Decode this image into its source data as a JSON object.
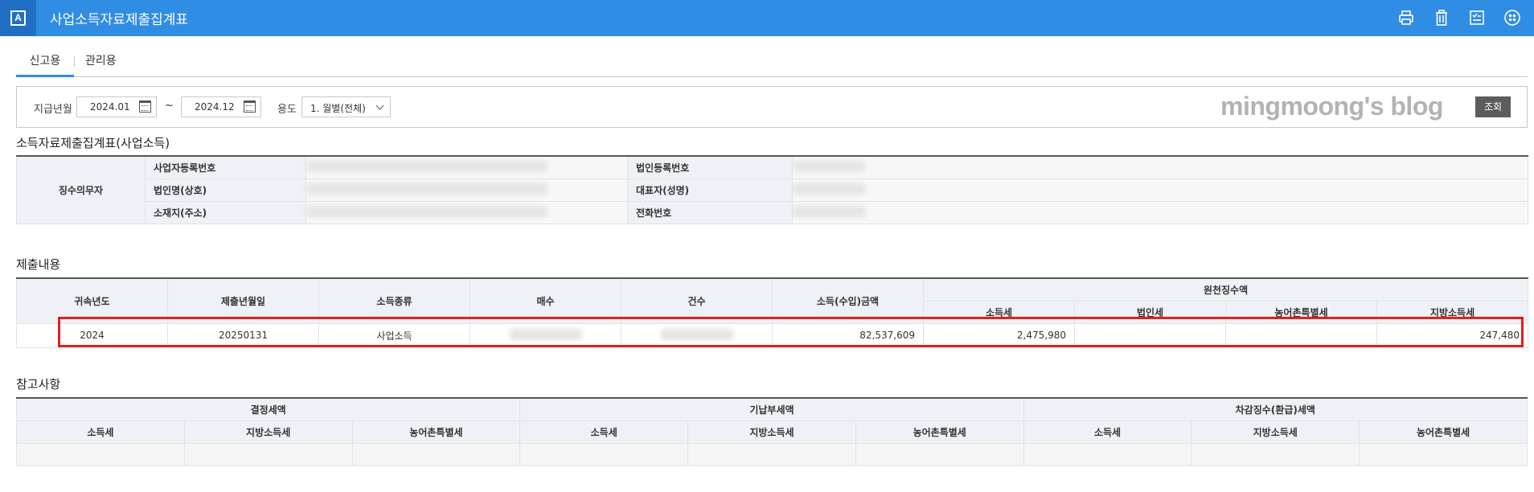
{
  "titlebar": {
    "app_icon_letter": "A",
    "title": "사업소득자료제출집계표",
    "icons": [
      "print-icon",
      "trash-icon",
      "checklist-icon",
      "more-icon"
    ]
  },
  "tabs": [
    {
      "label": "신고용",
      "active": true
    },
    {
      "label": "관리용",
      "active": false
    }
  ],
  "search": {
    "period_label": "지급년월",
    "from": "2024.01",
    "separator": "~",
    "to": "2024.12",
    "purpose_label": "용도",
    "purpose_value": "1. 월별(전체)",
    "watermark": "mingmoong's blog",
    "query_button": "조회"
  },
  "section1": {
    "title": "소득자료제출집계표(사업소득)",
    "group_label": "징수의무자",
    "labels": {
      "biz_reg_no": "사업자등록번호",
      "corp_name": "법인명(상호)",
      "address": "소재지(주소)",
      "corp_reg_no": "법인등록번호",
      "representative": "대표자(성명)",
      "phone": "전화번호"
    }
  },
  "section2": {
    "title": "제출내용",
    "headers": {
      "year": "귀속년도",
      "submit_date": "제출년월일",
      "income_type": "소득종류",
      "sheets": "매수",
      "count": "건수",
      "amount": "소득(수입)금액",
      "withholding": "원천징수액",
      "income_tax": "소득세",
      "corp_tax": "법인세",
      "rural_tax": "농어촌특별세",
      "local_tax": "지방소득세"
    },
    "row": {
      "year": "2024",
      "submit_date": "20250131",
      "income_type": "사업소득",
      "amount": "82,537,609",
      "income_tax": "2,475,980",
      "corp_tax": "",
      "rural_tax": "",
      "local_tax": "247,480"
    },
    "highlight_color": "#e02020"
  },
  "section3": {
    "title": "참고사항",
    "groups": [
      "결정세액",
      "기납부세액",
      "차감징수(환급)세액"
    ],
    "sub_headers": [
      "소득세",
      "지방소득세",
      "농어촌특별세"
    ]
  },
  "colors": {
    "titlebar": "#2f8de4",
    "accent": "#2f8de4",
    "header_bg": "#eef1f5",
    "query_button": "#5c5c5c"
  }
}
